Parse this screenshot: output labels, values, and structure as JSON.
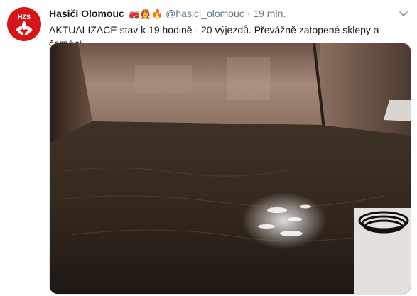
{
  "tweet": {
    "author_name": "Hasiči Olomouc",
    "author_emojis": "🚒👩‍🚒🔥",
    "handle": "@hasici_olomouc",
    "separator": "·",
    "time": "19 min.",
    "text": "AKTUALIZACE stav k 19 hodině - 20 výjezdů. Převážně zatopené sklepy a čerpání.",
    "avatar_label": "HZS",
    "avatar_color": "#d7141a",
    "icons": {
      "avatar": "hzs-logo-icon",
      "menu": "chevron-down-icon"
    },
    "media": {
      "description_hint": "flooded-basement-photo"
    }
  }
}
